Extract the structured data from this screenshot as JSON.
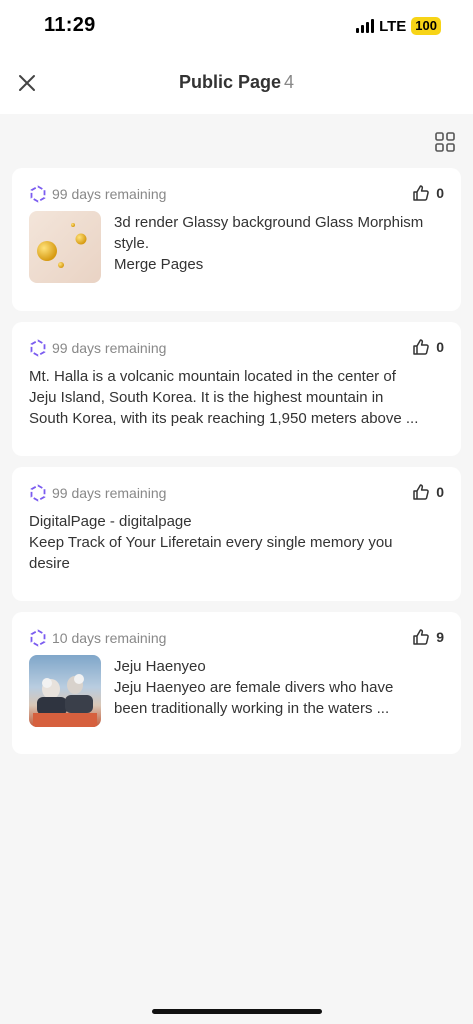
{
  "status_bar": {
    "time": "11:29",
    "network": "LTE",
    "battery": "100"
  },
  "header": {
    "title": "Public Page",
    "count": "4"
  },
  "cards": [
    {
      "meta": "99 days remaining",
      "likes": "0",
      "line1": "3d render Glassy background Glass Morphism",
      "line2": "style.",
      "line3": "Merge Pages"
    },
    {
      "meta": "99 days remaining",
      "likes": "0",
      "line1": "Mt. Halla is a volcanic mountain located in the center of",
      "line2": "Jeju Island, South Korea. It is the highest mountain in",
      "line3": "South Korea, with its peak reaching 1,950 meters above ..."
    },
    {
      "meta": "99 days remaining",
      "likes": "0",
      "line1": "DigitalPage - digitalpage",
      "line2": "Keep Track of Your Liferetain every single memory you",
      "line3": "desire"
    },
    {
      "meta": "10 days remaining",
      "likes": "9",
      "line1": "Jeju Haenyeo",
      "line2": "Jeju Haenyeo are female divers who have",
      "line3": "been traditionally working in the waters ..."
    }
  ]
}
